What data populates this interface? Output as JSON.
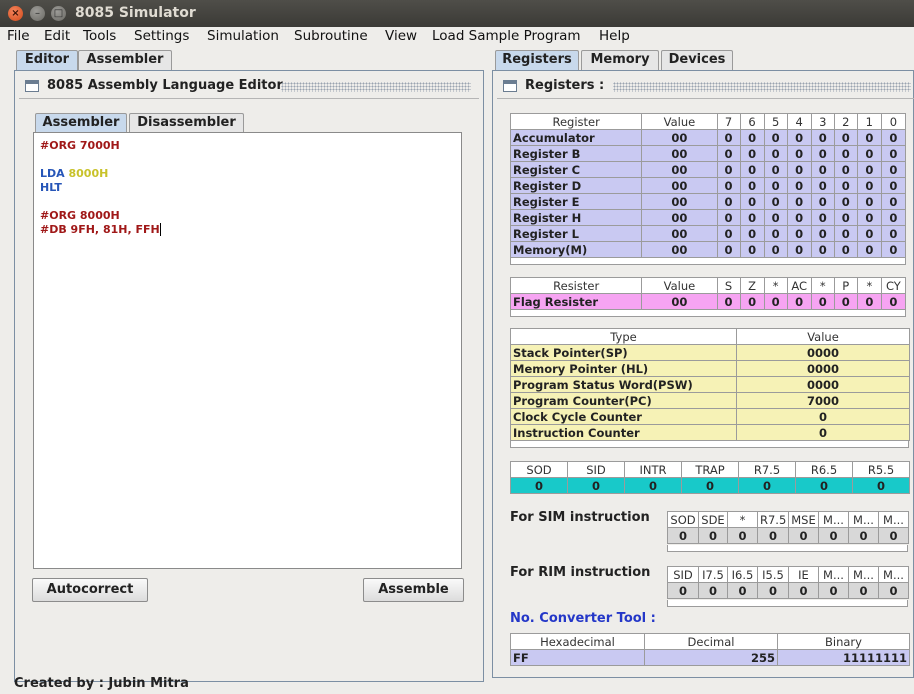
{
  "window": {
    "title": "8085 Simulator"
  },
  "menubar": [
    "File",
    "Edit",
    "Tools",
    "Settings",
    "Simulation",
    "Subroutine",
    "View",
    "Load Sample Program",
    "Help"
  ],
  "left_tabs": [
    "Editor",
    "Assembler"
  ],
  "right_tabs": [
    "Registers",
    "Memory",
    "Devices"
  ],
  "editor": {
    "title": "8085 Assembly Language Editor",
    "tabs": [
      "Assembler",
      "Disassembler"
    ],
    "lines": [
      [
        {
          "t": "#ORG 7000H",
          "c": "c-dir"
        }
      ],
      [],
      [
        {
          "t": "LDA ",
          "c": "c-op"
        },
        {
          "t": "8000H",
          "c": "c-num"
        }
      ],
      [
        {
          "t": "HLT",
          "c": "c-op"
        }
      ],
      [],
      [
        {
          "t": "#ORG 8000H",
          "c": "c-dir"
        }
      ],
      [
        {
          "t": "#DB 9FH, 81H, FFH",
          "c": "c-dir"
        }
      ]
    ],
    "autocorrect_label": "Autocorrect",
    "assemble_label": "Assemble"
  },
  "registers_panel": {
    "title": "Registers :",
    "register_table": {
      "headers": [
        "Register",
        "Value",
        "7",
        "6",
        "5",
        "4",
        "3",
        "2",
        "1",
        "0"
      ],
      "rows": [
        [
          "Accumulator",
          "00",
          "0",
          "0",
          "0",
          "0",
          "0",
          "0",
          "0",
          "0"
        ],
        [
          "Register B",
          "00",
          "0",
          "0",
          "0",
          "0",
          "0",
          "0",
          "0",
          "0"
        ],
        [
          "Register C",
          "00",
          "0",
          "0",
          "0",
          "0",
          "0",
          "0",
          "0",
          "0"
        ],
        [
          "Register D",
          "00",
          "0",
          "0",
          "0",
          "0",
          "0",
          "0",
          "0",
          "0"
        ],
        [
          "Register E",
          "00",
          "0",
          "0",
          "0",
          "0",
          "0",
          "0",
          "0",
          "0"
        ],
        [
          "Register H",
          "00",
          "0",
          "0",
          "0",
          "0",
          "0",
          "0",
          "0",
          "0"
        ],
        [
          "Register L",
          "00",
          "0",
          "0",
          "0",
          "0",
          "0",
          "0",
          "0",
          "0"
        ],
        [
          "Memory(M)",
          "00",
          "0",
          "0",
          "0",
          "0",
          "0",
          "0",
          "0",
          "0"
        ]
      ]
    },
    "flag_table": {
      "headers": [
        "Resister",
        "Value",
        "S",
        "Z",
        "*",
        "AC",
        "*",
        "P",
        "*",
        "CY"
      ],
      "rows": [
        [
          "Flag Resister",
          "00",
          "0",
          "0",
          "0",
          "0",
          "0",
          "0",
          "0",
          "0"
        ]
      ]
    },
    "type_table": {
      "headers": [
        "Type",
        "Value"
      ],
      "rows": [
        [
          "Stack Pointer(SP)",
          "0000"
        ],
        [
          "Memory Pointer (HL)",
          "0000"
        ],
        [
          "Program Status Word(PSW)",
          "0000"
        ],
        [
          "Program Counter(PC)",
          "7000"
        ],
        [
          "Clock Cycle Counter",
          "0"
        ],
        [
          "Instruction Counter",
          "0"
        ]
      ]
    },
    "interrupt_table": {
      "headers": [
        "SOD",
        "SID",
        "INTR",
        "TRAP",
        "R7.5",
        "R6.5",
        "R5.5"
      ],
      "values": [
        "0",
        "0",
        "0",
        "0",
        "0",
        "0",
        "0"
      ]
    },
    "sim_label": "For SIM instruction",
    "sim_table": {
      "headers": [
        "SOD",
        "SDE",
        "*",
        "R7.5",
        "MSE",
        "M...",
        "M...",
        "M..."
      ],
      "values": [
        "0",
        "0",
        "0",
        "0",
        "0",
        "0",
        "0",
        "0"
      ]
    },
    "rim_label": "For RIM instruction",
    "rim_table": {
      "headers": [
        "SID",
        "I7.5",
        "I6.5",
        "I5.5",
        "IE",
        "M...",
        "M...",
        "M..."
      ],
      "values": [
        "0",
        "0",
        "0",
        "0",
        "0",
        "0",
        "0",
        "0"
      ]
    },
    "converter_label": "No. Converter Tool :",
    "converter_table": {
      "headers": [
        "Hexadecimal",
        "Decimal",
        "Binary"
      ],
      "values": [
        "FF",
        "255",
        "11111111"
      ]
    }
  },
  "footer": "Created by : Jubin Mitra",
  "colors": {
    "register_rows": "#c9c9f2",
    "flag_row": "#f6a4f2",
    "type_rows": "#f6f2b6",
    "interrupt_row": "#18c9c9",
    "converter_title": "#2437c8",
    "directive": "#a01818",
    "opcode": "#2655b8",
    "number": "#c8c22a"
  }
}
